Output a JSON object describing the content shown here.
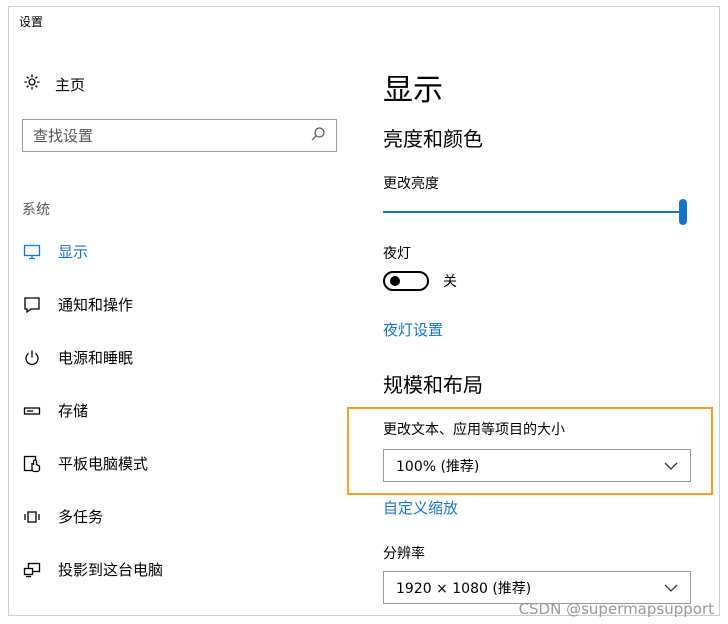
{
  "window": {
    "title": "设置"
  },
  "sidebar": {
    "home_label": "主页",
    "search_placeholder": "查找设置",
    "section_label": "系统",
    "items": [
      {
        "label": "显示",
        "icon": "monitor-icon",
        "active": true
      },
      {
        "label": "通知和操作",
        "icon": "notification-icon"
      },
      {
        "label": "电源和睡眠",
        "icon": "power-icon"
      },
      {
        "label": "存储",
        "icon": "storage-icon"
      },
      {
        "label": "平板电脑模式",
        "icon": "tablet-mode-icon"
      },
      {
        "label": "多任务",
        "icon": "multitask-icon"
      },
      {
        "label": "投影到这台电脑",
        "icon": "project-icon"
      }
    ]
  },
  "main": {
    "title": "显示",
    "brightness_section": "亮度和颜色",
    "brightness_label": "更改亮度",
    "brightness_value": 100,
    "night_light_label": "夜灯",
    "night_light_state": "关",
    "night_light_settings_link": "夜灯设置",
    "scale_section": "规模和布局",
    "scale_label": "更改文本、应用等项目的大小",
    "scale_value": "100% (推荐)",
    "custom_scale_link": "自定义缩放",
    "resolution_label": "分辨率",
    "resolution_value": "1920 × 1080 (推荐)"
  },
  "watermark": "CSDN @supermapsupport",
  "colors": {
    "accent": "#1a73c8",
    "highlight_border": "#f0a030"
  }
}
